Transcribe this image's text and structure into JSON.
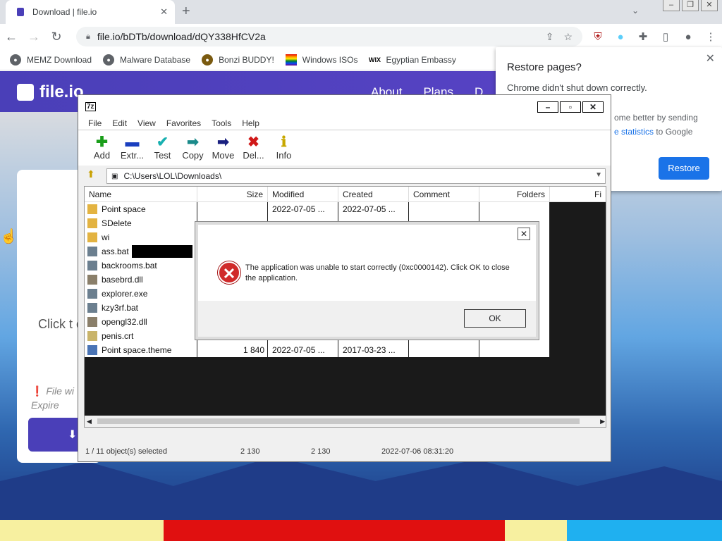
{
  "browser": {
    "tab_title": "Download | file.io",
    "url": "file.io/bDTb/download/dQY338HfCV2a",
    "bookmarks": [
      "MEMZ Download",
      "Malware Database",
      "Bonzi BUDDY!",
      "Windows ISOs",
      "Egyptian Embassy"
    ]
  },
  "page": {
    "logo": "file.io",
    "nav": [
      "About",
      "Plans",
      "D"
    ],
    "click_text": "Click t do",
    "file_will": "File wi",
    "expire": "Expire"
  },
  "restore_popup": {
    "title": "Restore pages?",
    "body": "Chrome didn't shut down correctly.",
    "body2a": "ome better by sending",
    "body2b_link": "e statistics",
    "body2c": " to Google",
    "button": "Restore"
  },
  "sevenzip": {
    "title_icon": "7z",
    "menu": [
      "File",
      "Edit",
      "View",
      "Favorites",
      "Tools",
      "Help"
    ],
    "tools": [
      {
        "label": "Add",
        "glyph": "+",
        "color": "#1a9e1a",
        "icon": "add-icon"
      },
      {
        "label": "Extr...",
        "glyph": "−",
        "color": "#1a3fbf",
        "icon": "extract-icon"
      },
      {
        "label": "Test",
        "glyph": "✔",
        "color": "#18b0b0",
        "icon": "test-icon"
      },
      {
        "label": "Copy",
        "glyph": "➡",
        "color": "#1a8a8a",
        "icon": "copy-icon"
      },
      {
        "label": "Move",
        "glyph": "➡",
        "color": "#1a2080",
        "icon": "move-icon"
      },
      {
        "label": "Del...",
        "glyph": "✖",
        "color": "#d01818",
        "icon": "delete-icon"
      },
      {
        "label": "Info",
        "glyph": "ℹ",
        "color": "#c8a800",
        "icon": "info-icon"
      }
    ],
    "path": "C:\\Users\\LOL\\Downloads\\",
    "columns": [
      "Name",
      "Size",
      "Modified",
      "Created",
      "Comment",
      "Folders",
      "Fi"
    ],
    "files": [
      {
        "name": "Point space",
        "size": "",
        "modified": "2022-07-05 ...",
        "created": "2022-07-05 ...",
        "type": "folder"
      },
      {
        "name": "SDelete",
        "size": "",
        "modified": "",
        "created": "",
        "type": "folder"
      },
      {
        "name": "wi",
        "size": "",
        "modified": "",
        "created": "",
        "type": "folder"
      },
      {
        "name": "ass.bat",
        "size": "",
        "modified": "",
        "created": "",
        "type": "bat"
      },
      {
        "name": "backrooms.bat",
        "size": "",
        "modified": "",
        "created": "",
        "type": "bat"
      },
      {
        "name": "basebrd.dll",
        "size": "",
        "modified": "",
        "created": "",
        "type": "dll"
      },
      {
        "name": "explorer.exe",
        "size": "",
        "modified": "",
        "created": "",
        "type": "exe"
      },
      {
        "name": "kzy3rf.bat",
        "size": "",
        "modified": "",
        "created": "",
        "type": "bat"
      },
      {
        "name": "opengl32.dll",
        "size": "",
        "modified": "",
        "created": "",
        "type": "dll"
      },
      {
        "name": "penis.crt",
        "size": "",
        "modified": "",
        "created": "",
        "type": "crt"
      },
      {
        "name": "Point space.theme",
        "size": "1 840",
        "modified": "2022-07-05 ...",
        "created": "2017-03-23 ...",
        "type": "theme"
      }
    ],
    "status": {
      "selected": "1 / 11 object(s) selected",
      "size1": "2 130",
      "size2": "2 130",
      "date": "2022-07-06 08:31:20"
    }
  },
  "error_dialog": {
    "message": "The application was unable to start correctly (0xc0000142). Click OK to close the application.",
    "ok": "OK"
  }
}
